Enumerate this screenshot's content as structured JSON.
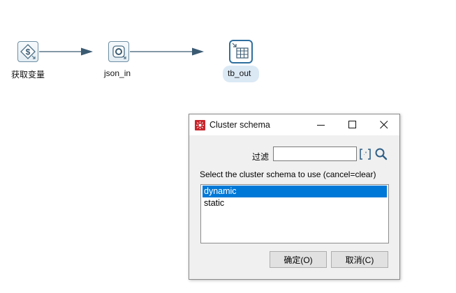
{
  "canvas": {
    "steps": [
      {
        "label": "获取变量",
        "icon": "dollar-variable-icon"
      },
      {
        "label": "json_in",
        "icon": "json-input-icon"
      },
      {
        "label": "tb_out",
        "icon": "table-output-icon"
      }
    ],
    "hop_color": "#3b5b72",
    "selected_step_highlight": "#dbe9f5"
  },
  "dialog": {
    "title": "Cluster schema",
    "filter_label": "过滤",
    "filter_value": "",
    "instruction": "Select the cluster schema to use (cancel=clear)",
    "options": [
      "dynamic",
      "static"
    ],
    "selected_option": "dynamic",
    "ok_label": "确定(O)",
    "cancel_label": "取消(C)",
    "selection_color": "#0078d7"
  }
}
